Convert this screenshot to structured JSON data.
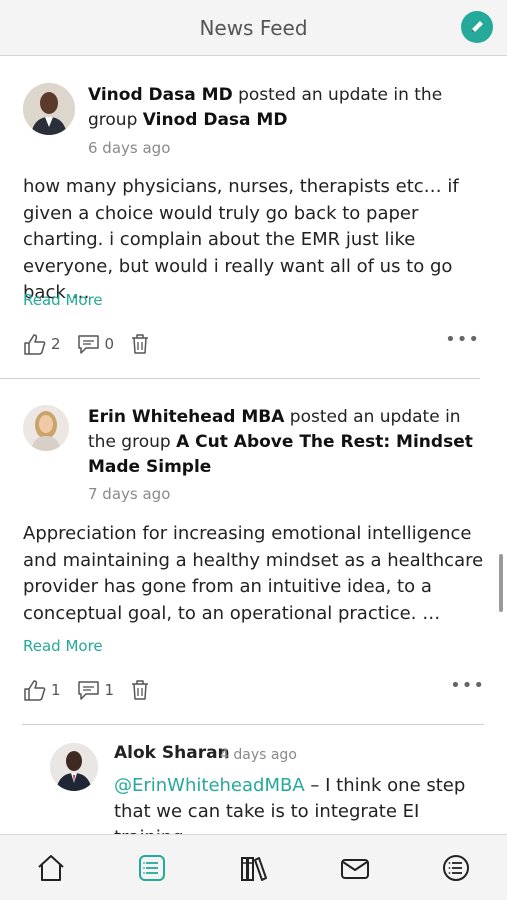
{
  "header": {
    "title": "News Feed",
    "compose_icon": "pencil-icon",
    "accent_color": "#25a99a"
  },
  "posts": [
    {
      "author": "Vinod Dasa MD",
      "action_text": " posted an update in the group ",
      "group": "Vinod Dasa MD",
      "time": "6 days ago",
      "body": "how many physicians, nurses, therapists etc… if given a choice would truly go back to paper charting. i complain about the EMR just like everyone, but would i really want all of us to go back …",
      "read_more": "Read More",
      "likes": "2",
      "comments": "0"
    },
    {
      "author": "Erin Whitehead MBA",
      "action_text": " posted an update in the group ",
      "group": "A Cut Above The Rest: Mindset Made Simple",
      "time": "7 days ago",
      "body": "Appreciation for increasing emotional intelligence and maintaining a healthy mindset as a healthcare provider has gone from an intuitive idea, to a conceptual goal, to an operational practice. …",
      "read_more": "Read More",
      "likes": "1",
      "comments": "1"
    }
  ],
  "comment": {
    "author": "Alok Sharan",
    "time": "4 days ago",
    "mention": "@ErinWhiteheadMBA",
    "text": " – I think one step that we can take is to integrate EI training"
  },
  "tabs": [
    {
      "icon": "home-icon"
    },
    {
      "icon": "activity-feed-icon",
      "active": true
    },
    {
      "icon": "library-icon"
    },
    {
      "icon": "messages-icon"
    },
    {
      "icon": "menu-icon"
    }
  ]
}
